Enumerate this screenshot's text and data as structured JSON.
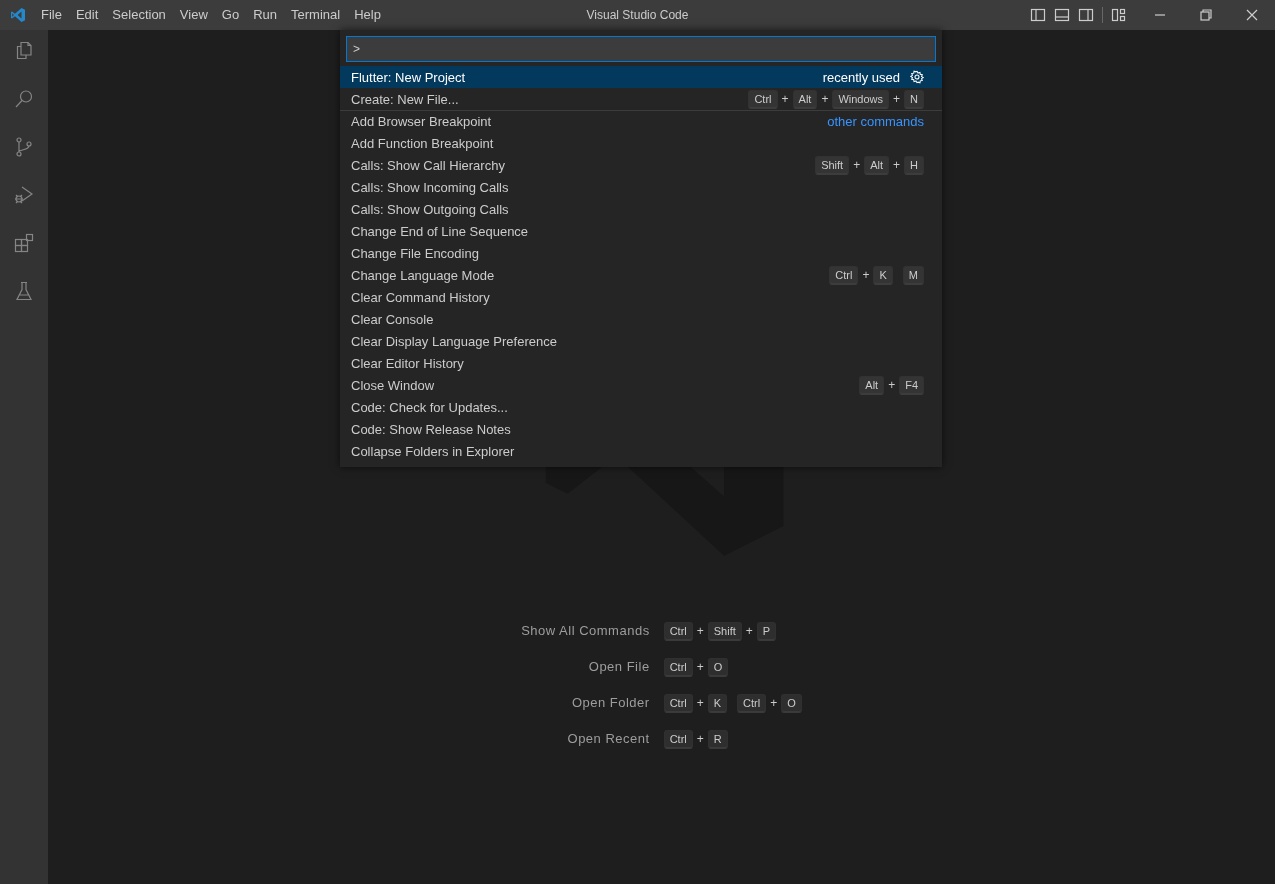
{
  "title_bar": {
    "menu": [
      "File",
      "Edit",
      "Selection",
      "View",
      "Go",
      "Run",
      "Terminal",
      "Help"
    ],
    "title": "Visual Studio Code"
  },
  "command_palette": {
    "input": {
      "value": ">"
    },
    "items": [
      {
        "label": "Flutter: New Project",
        "selected": true,
        "group_label": "recently used",
        "kind": "recent"
      },
      {
        "label": "Create: New File...",
        "selected": false,
        "keys": [
          [
            "Ctrl",
            "+",
            "Alt",
            "+",
            "Windows",
            "+",
            "N"
          ]
        ]
      },
      {
        "label": "Add Browser Breakpoint",
        "selected": false,
        "group_label": "other commands",
        "kind": "group-start"
      },
      {
        "label": "Add Function Breakpoint",
        "selected": false
      },
      {
        "label": "Calls: Show Call Hierarchy",
        "selected": false,
        "keys": [
          [
            "Shift",
            "+",
            "Alt",
            "+",
            "H"
          ]
        ]
      },
      {
        "label": "Calls: Show Incoming Calls",
        "selected": false
      },
      {
        "label": "Calls: Show Outgoing Calls",
        "selected": false
      },
      {
        "label": "Change End of Line Sequence",
        "selected": false
      },
      {
        "label": "Change File Encoding",
        "selected": false
      },
      {
        "label": "Change Language Mode",
        "selected": false,
        "keys": [
          [
            "Ctrl",
            "+",
            "K"
          ],
          [
            "M"
          ]
        ]
      },
      {
        "label": "Clear Command History",
        "selected": false
      },
      {
        "label": "Clear Console",
        "selected": false
      },
      {
        "label": "Clear Display Language Preference",
        "selected": false
      },
      {
        "label": "Clear Editor History",
        "selected": false
      },
      {
        "label": "Close Window",
        "selected": false,
        "keys": [
          [
            "Alt",
            "+",
            "F4"
          ]
        ]
      },
      {
        "label": "Code: Check for Updates...",
        "selected": false
      },
      {
        "label": "Code: Show Release Notes",
        "selected": false
      },
      {
        "label": "Collapse Folders in Explorer",
        "selected": false
      }
    ]
  },
  "welcome": {
    "shortcuts": [
      {
        "label": "Show All Commands",
        "keys": [
          [
            "Ctrl",
            "+",
            "Shift",
            "+",
            "P"
          ]
        ]
      },
      {
        "label": "Open File",
        "keys": [
          [
            "Ctrl",
            "+",
            "O"
          ]
        ]
      },
      {
        "label": "Open Folder",
        "keys": [
          [
            "Ctrl",
            "+",
            "K"
          ],
          [
            "Ctrl",
            "+",
            "O"
          ]
        ]
      },
      {
        "label": "Open Recent",
        "keys": [
          [
            "Ctrl",
            "+",
            "R"
          ]
        ]
      }
    ]
  }
}
